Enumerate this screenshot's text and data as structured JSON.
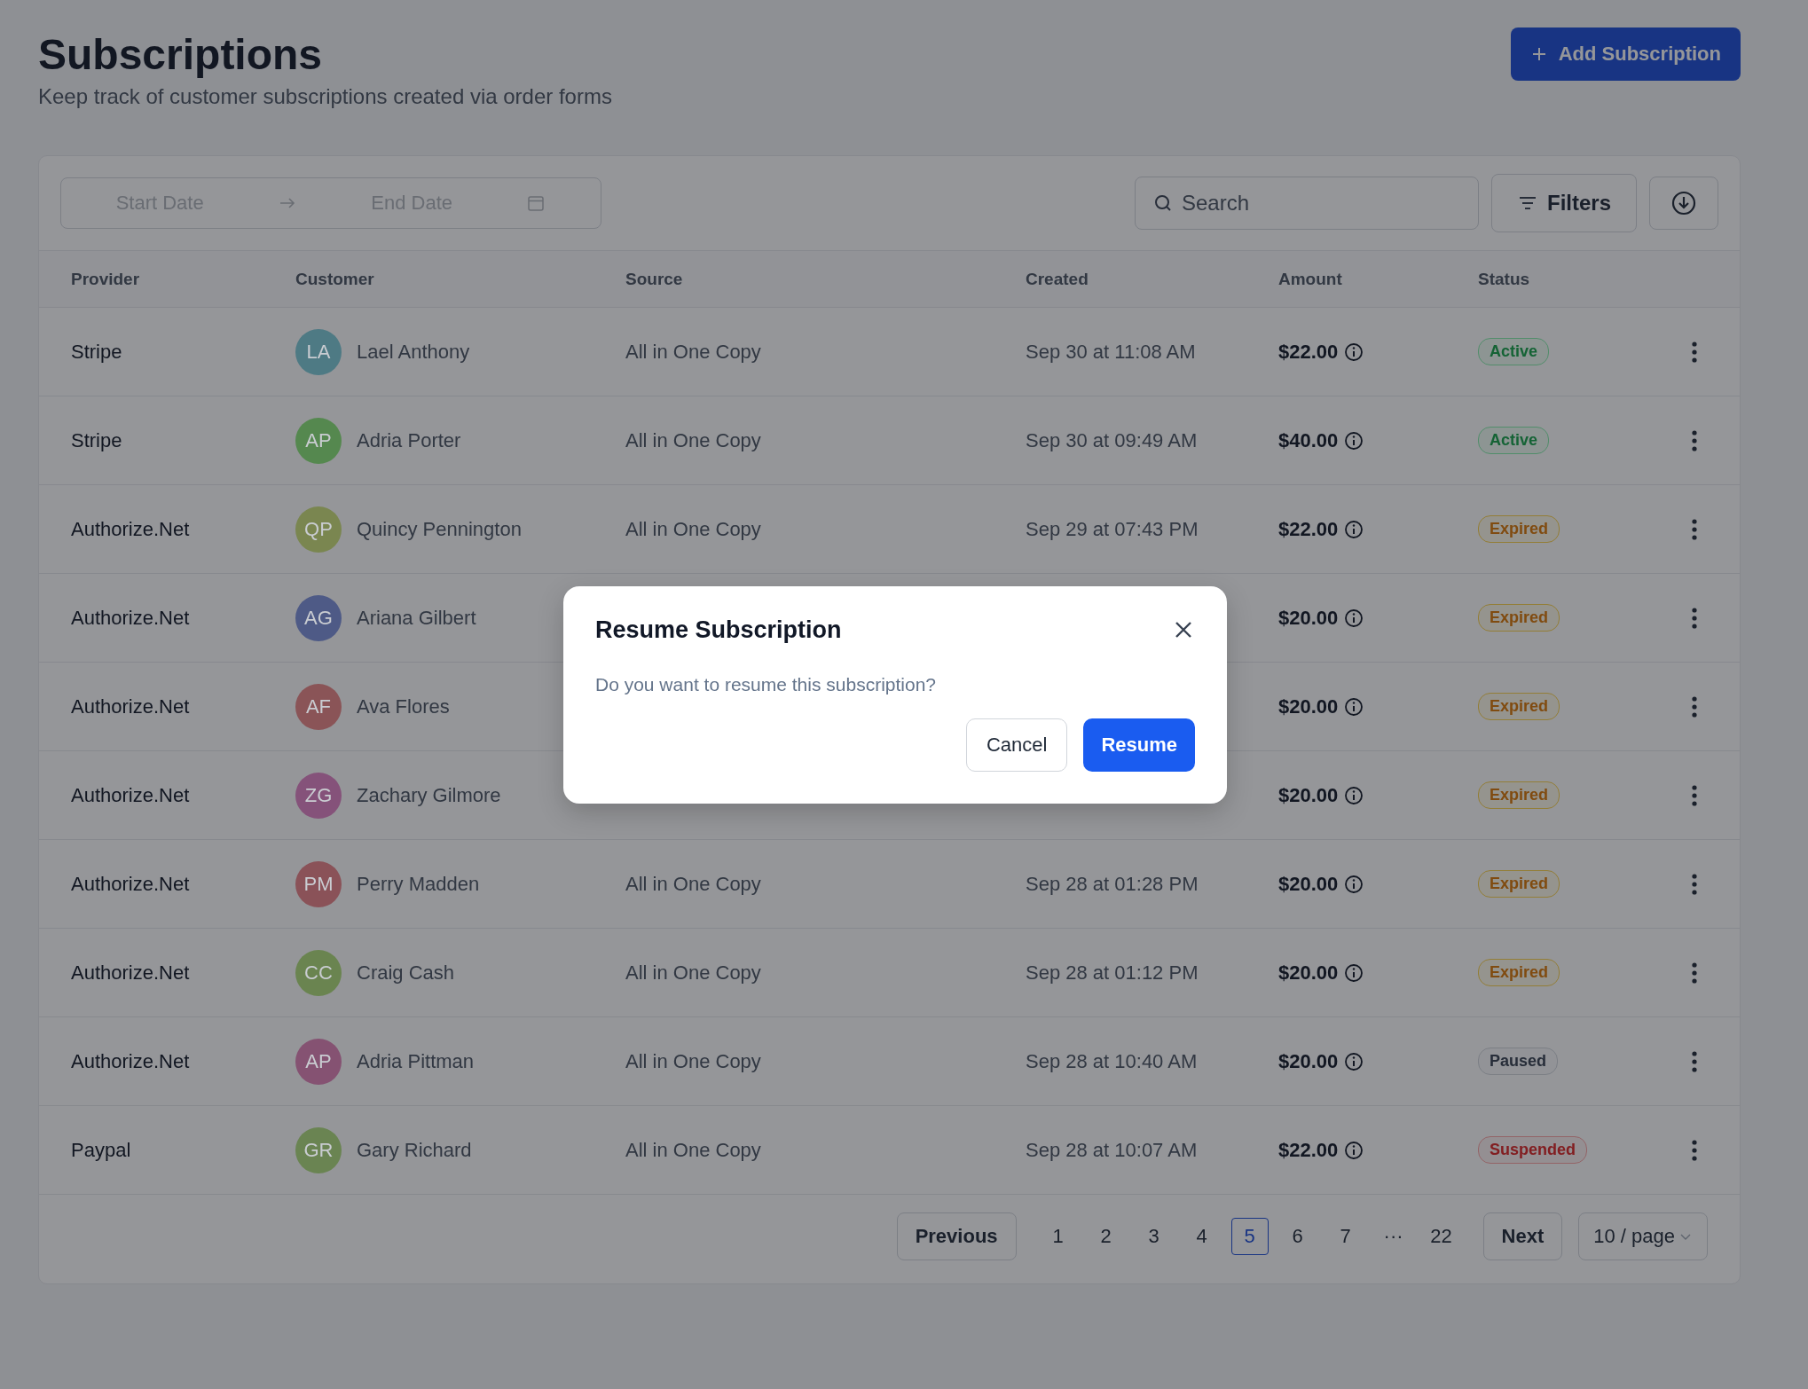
{
  "header": {
    "title": "Subscriptions",
    "subtitle": "Keep track of customer subscriptions created via order forms",
    "add_button": "Add Subscription"
  },
  "toolbar": {
    "start_placeholder": "Start Date",
    "end_placeholder": "End Date",
    "search_placeholder": "Search",
    "filters_button": "Filters"
  },
  "table": {
    "columns": [
      "Provider",
      "Customer",
      "Source",
      "Created",
      "Amount",
      "Status"
    ],
    "rows": [
      {
        "provider": "Stripe",
        "initials": "LA",
        "color": "#4e7a84",
        "customer": "Lael Anthony",
        "source": "All in One Copy",
        "created": "Sep 30 at 11:08 AM",
        "amount": "$22.00",
        "status": "Active",
        "kind": "active"
      },
      {
        "provider": "Stripe",
        "initials": "AP",
        "color": "#55884f",
        "customer": "Adria Porter",
        "source": "All in One Copy",
        "created": "Sep 30 at 09:49 AM",
        "amount": "$40.00",
        "status": "Active",
        "kind": "active"
      },
      {
        "provider": "Authorize.Net",
        "initials": "QP",
        "color": "#7a8650",
        "customer": "Quincy Pennington",
        "source": "All in One Copy",
        "created": "Sep 29 at 07:43 PM",
        "amount": "$22.00",
        "status": "Expired",
        "kind": "expired"
      },
      {
        "provider": "Authorize.Net",
        "initials": "AG",
        "color": "#4e5a86",
        "customer": "Ariana Gilbert",
        "amount": "$20.00",
        "status": "Expired",
        "kind": "expired"
      },
      {
        "provider": "Authorize.Net",
        "initials": "AF",
        "color": "#8a5457",
        "customer": "Ava Flores",
        "amount": "$20.00",
        "status": "Expired",
        "kind": "expired"
      },
      {
        "provider": "Authorize.Net",
        "initials": "ZG",
        "color": "#85527a",
        "customer": "Zachary Gilmore",
        "amount": "$20.00",
        "status": "Expired",
        "kind": "expired"
      },
      {
        "provider": "Authorize.Net",
        "initials": "PM",
        "color": "#8a5258",
        "customer": "Perry Madden",
        "source": "All in One Copy",
        "created": "Sep 28 at 01:28 PM",
        "amount": "$20.00",
        "status": "Expired",
        "kind": "expired"
      },
      {
        "provider": "Authorize.Net",
        "initials": "CC",
        "color": "#6a8450",
        "customer": "Craig Cash",
        "source": "All in One Copy",
        "created": "Sep 28 at 01:12 PM",
        "amount": "$20.00",
        "status": "Expired",
        "kind": "expired"
      },
      {
        "provider": "Authorize.Net",
        "initials": "AP",
        "color": "#855272",
        "customer": "Adria Pittman",
        "source": "All in One Copy",
        "created": "Sep 28 at 10:40 AM",
        "amount": "$20.00",
        "status": "Paused",
        "kind": "paused"
      },
      {
        "provider": "Paypal",
        "initials": "GR",
        "color": "#6a8452",
        "customer": "Gary Richard",
        "source": "All in One Copy",
        "created": "Sep 28 at 10:07 AM",
        "amount": "$22.00",
        "status": "Suspended",
        "kind": "suspended"
      }
    ]
  },
  "pagination": {
    "previous": "Previous",
    "next": "Next",
    "per_page": "10 / page",
    "pages": [
      {
        "label": "1",
        "selected": false
      },
      {
        "label": "2",
        "selected": false
      },
      {
        "label": "3",
        "selected": false
      },
      {
        "label": "4",
        "selected": false
      },
      {
        "label": "5",
        "selected": true
      },
      {
        "label": "6",
        "selected": false
      },
      {
        "label": "7",
        "selected": false
      },
      {
        "label": "···",
        "selected": false
      },
      {
        "label": "22",
        "selected": false
      }
    ]
  },
  "dialog": {
    "title": "Resume Subscription",
    "message": "Do you want to resume this subscription?",
    "cancel": "Cancel",
    "confirm": "Resume"
  }
}
